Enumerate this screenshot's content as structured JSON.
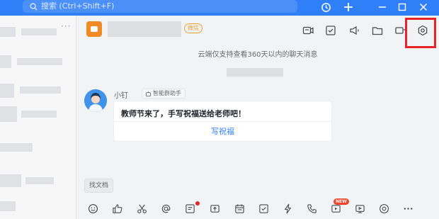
{
  "titlebar": {
    "search_placeholder": "搜索 (Ctrl+Shift+F)",
    "accent": "#2f7ff8",
    "icons": [
      "search-icon",
      "history-icon",
      "plus-icon",
      "minimize-icon",
      "maximize-icon",
      "close-icon"
    ]
  },
  "sidebar": {
    "more_label": "···"
  },
  "chat": {
    "group_badge": "微信",
    "header_icons": [
      "video-icon",
      "todo-icon",
      "announcement-icon",
      "folder-icon",
      "screen-icon",
      "settings-icon"
    ],
    "cloud_notice": "云端仅支持查看360天以内的聊天消息",
    "message": {
      "sender": "小钉",
      "tag": "智能群助手",
      "text": "教师节来了，手写祝福送给老师吧！",
      "action": "写祝福"
    },
    "find_doc": "找文档",
    "new_badge": "NEW",
    "bottom_icons": [
      "emoji-icon",
      "thumb-icon",
      "scissors-icon",
      "at-icon",
      "quick-reply-icon",
      "upload-icon",
      "calendar-icon",
      "check-icon",
      "ding-icon",
      "call-icon",
      "live-icon",
      "meeting-icon",
      "emotion-icon",
      "more-icon"
    ]
  }
}
